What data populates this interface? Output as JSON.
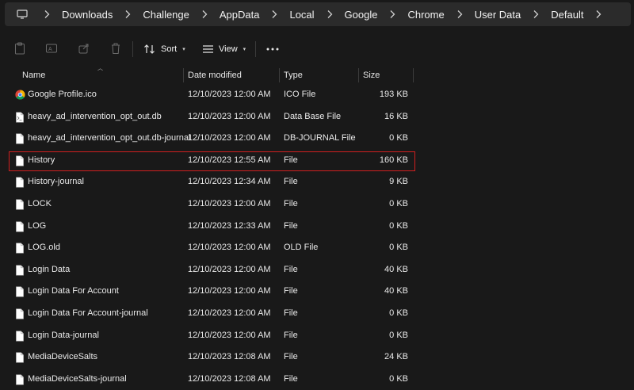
{
  "breadcrumb": [
    "Downloads",
    "Challenge",
    "AppData",
    "Local",
    "Google",
    "Chrome",
    "User Data",
    "Default"
  ],
  "toolbar": {
    "sort_label": "Sort",
    "view_label": "View"
  },
  "columns": {
    "name": "Name",
    "date": "Date modified",
    "type": "Type",
    "size": "Size"
  },
  "files": [
    {
      "name": "Google Profile.ico",
      "date": "12/10/2023 12:00 AM",
      "type": "ICO File",
      "size": "193 KB",
      "icon": "chrome-icon"
    },
    {
      "name": "heavy_ad_intervention_opt_out.db",
      "date": "12/10/2023 12:00 AM",
      "type": "Data Base File",
      "size": "16 KB",
      "icon": "database-file-icon"
    },
    {
      "name": "heavy_ad_intervention_opt_out.db-journal",
      "date": "12/10/2023 12:00 AM",
      "type": "DB-JOURNAL File",
      "size": "0 KB",
      "icon": "file-icon"
    },
    {
      "name": "History",
      "date": "12/10/2023 12:55 AM",
      "type": "File",
      "size": "160 KB",
      "icon": "file-icon",
      "highlighted": true
    },
    {
      "name": "History-journal",
      "date": "12/10/2023 12:34 AM",
      "type": "File",
      "size": "9 KB",
      "icon": "file-icon"
    },
    {
      "name": "LOCK",
      "date": "12/10/2023 12:00 AM",
      "type": "File",
      "size": "0 KB",
      "icon": "file-icon"
    },
    {
      "name": "LOG",
      "date": "12/10/2023 12:33 AM",
      "type": "File",
      "size": "0 KB",
      "icon": "file-icon"
    },
    {
      "name": "LOG.old",
      "date": "12/10/2023 12:00 AM",
      "type": "OLD File",
      "size": "0 KB",
      "icon": "file-icon"
    },
    {
      "name": "Login Data",
      "date": "12/10/2023 12:00 AM",
      "type": "File",
      "size": "40 KB",
      "icon": "file-icon"
    },
    {
      "name": "Login Data For Account",
      "date": "12/10/2023 12:00 AM",
      "type": "File",
      "size": "40 KB",
      "icon": "file-icon"
    },
    {
      "name": "Login Data For Account-journal",
      "date": "12/10/2023 12:00 AM",
      "type": "File",
      "size": "0 KB",
      "icon": "file-icon"
    },
    {
      "name": "Login Data-journal",
      "date": "12/10/2023 12:00 AM",
      "type": "File",
      "size": "0 KB",
      "icon": "file-icon"
    },
    {
      "name": "MediaDeviceSalts",
      "date": "12/10/2023 12:08 AM",
      "type": "File",
      "size": "24 KB",
      "icon": "file-icon"
    },
    {
      "name": "MediaDeviceSalts-journal",
      "date": "12/10/2023 12:08 AM",
      "type": "File",
      "size": "0 KB",
      "icon": "file-icon"
    }
  ],
  "colors": {
    "background": "#191919",
    "breadcrumb_bg": "#2b2b2b",
    "highlight": "#d11f1f"
  }
}
